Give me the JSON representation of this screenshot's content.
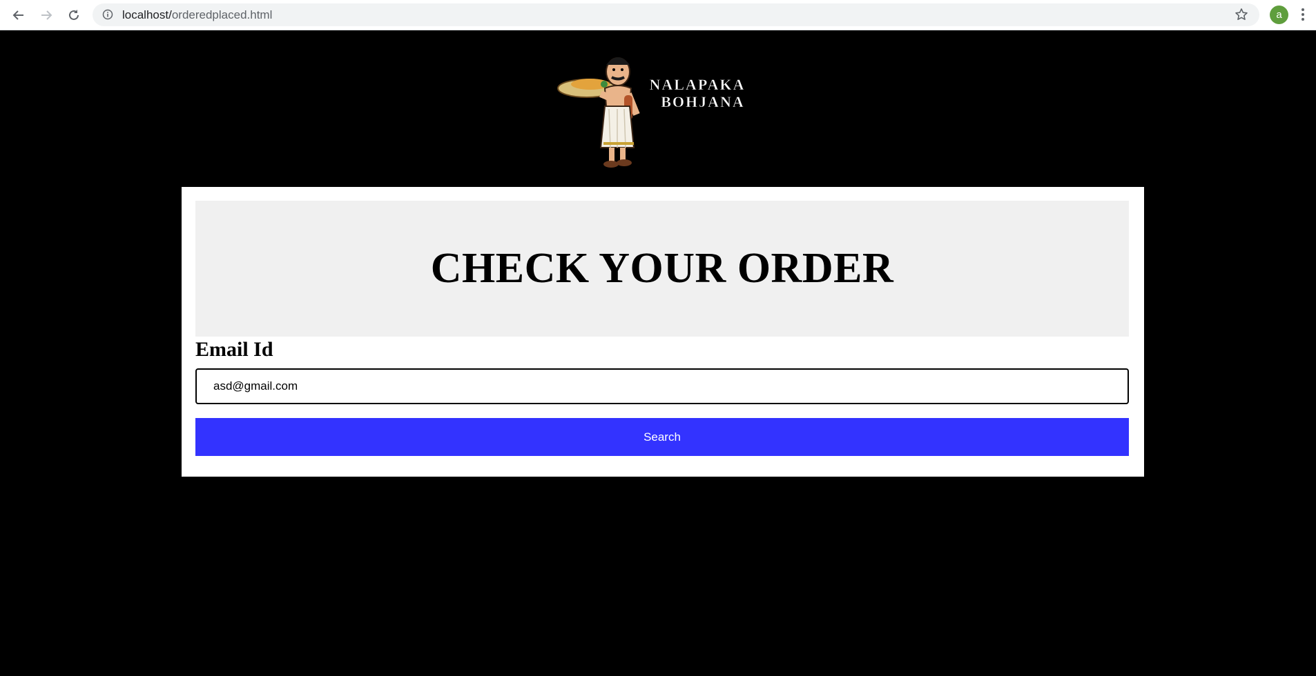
{
  "browser": {
    "url_host": "localhost/",
    "url_path": "orderedplaced.html",
    "avatar_letter": "a"
  },
  "logo": {
    "line1": "NALAPAKA",
    "line2": "BOHJANA"
  },
  "card": {
    "heading": "CHECK YOUR ORDER",
    "email_label": "Email Id",
    "email_value": "asd@gmail.com",
    "search_label": "Search"
  },
  "colors": {
    "page_background": "#000000",
    "button": "#3333ff",
    "banner": "#f0f0f0"
  }
}
